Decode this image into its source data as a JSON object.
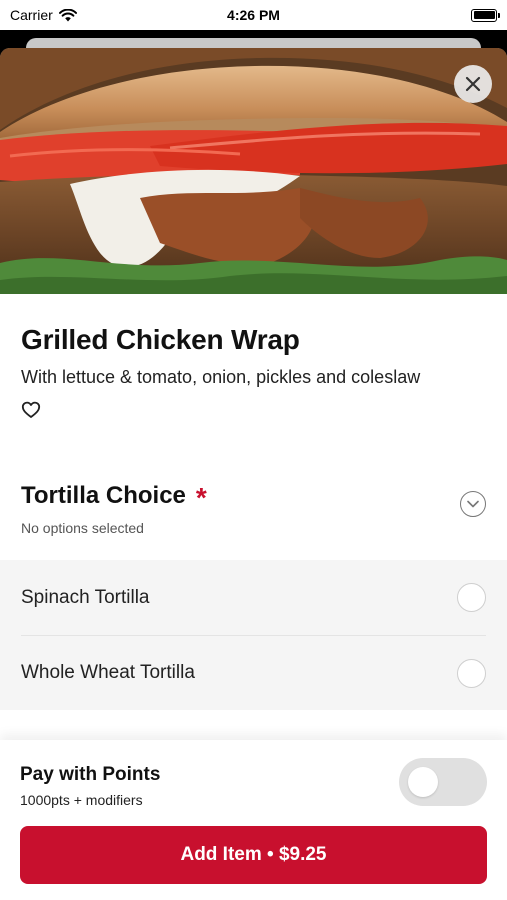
{
  "status_bar": {
    "carrier": "Carrier",
    "time": "4:26 PM"
  },
  "item": {
    "title": "Grilled Chicken Wrap",
    "description": "With lettuce & tomato, onion, pickles and coleslaw"
  },
  "option_group": {
    "title": "Tortilla Choice",
    "required_mark": "*",
    "status": "No options selected",
    "options": [
      {
        "label": "Spinach Tortilla",
        "selected": false
      },
      {
        "label": "Whole Wheat Tortilla",
        "selected": false
      }
    ]
  },
  "points": {
    "title": "Pay with Points",
    "subtitle": "1000pts + modifiers",
    "enabled": false
  },
  "add_button": {
    "label": "Add Item • $9.25"
  },
  "colors": {
    "accent": "#c8102e",
    "toggle_off": "#e0e0e0",
    "list_bg": "#f5f5f5"
  },
  "icons": [
    "wifi-icon",
    "battery-icon",
    "close-icon",
    "heart-icon",
    "chevron-down-icon"
  ]
}
